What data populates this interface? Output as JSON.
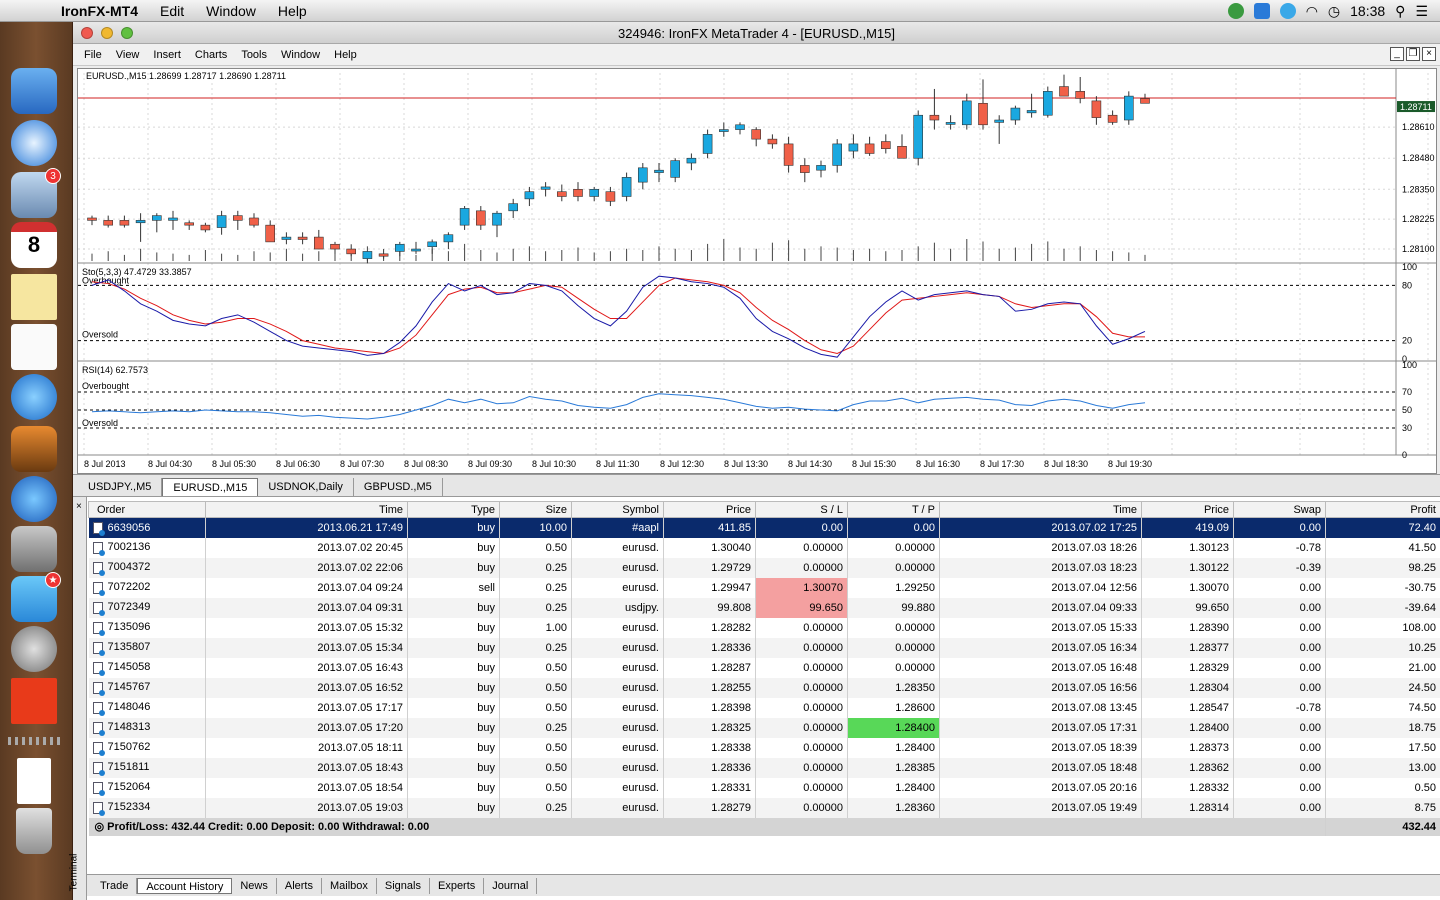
{
  "menubar": {
    "app": "IronFX-MT4",
    "items": [
      "Edit",
      "Window",
      "Help"
    ],
    "clock": "18:38"
  },
  "dock": {
    "items": [
      "finder-icon",
      "safari-icon",
      "mail-icon",
      "calendar-icon",
      "notes-icon",
      "reminders-icon",
      "itunes-icon",
      "iphoto-icon",
      "app-store-icon",
      "system-preferences-icon",
      "twitter-icon",
      "disk-utility-icon",
      "ironfx-icon",
      "document-icon",
      "trash-icon"
    ],
    "mail_badge": "3",
    "calendar_day": "8"
  },
  "window": {
    "title": "324946: IronFX MetaTrader 4 - [EURUSD.,M15]",
    "menu": [
      "File",
      "View",
      "Insert",
      "Charts",
      "Tools",
      "Window",
      "Help"
    ]
  },
  "chart_data": {
    "type": "candlestick",
    "header": "EURUSD.,M15  1.28699 1.28717 1.28690 1.28711",
    "price_labels": [
      "1.28610",
      "1.28480",
      "1.28350",
      "1.28225",
      "1.28100"
    ],
    "current_price": "1.28711",
    "ylim": [
      1.2805,
      1.2882
    ],
    "candles": [
      [
        1.2823,
        1.2824,
        1.282,
        1.2822
      ],
      [
        1.2822,
        1.2824,
        1.2819,
        1.282
      ],
      [
        1.2822,
        1.2824,
        1.2819,
        1.282
      ],
      [
        1.2821,
        1.2825,
        1.2813,
        1.2822
      ],
      [
        1.2822,
        1.2825,
        1.2817,
        1.2824
      ],
      [
        1.2822,
        1.2826,
        1.2818,
        1.2823
      ],
      [
        1.2821,
        1.2822,
        1.2818,
        1.282
      ],
      [
        1.282,
        1.2821,
        1.2817,
        1.2818
      ],
      [
        1.2819,
        1.2826,
        1.2816,
        1.2824
      ],
      [
        1.2824,
        1.2826,
        1.2818,
        1.2822
      ],
      [
        1.2823,
        1.2825,
        1.2819,
        1.282
      ],
      [
        1.282,
        1.2822,
        1.2813,
        1.2813
      ],
      [
        1.2814,
        1.2817,
        1.2812,
        1.2815
      ],
      [
        1.2815,
        1.2817,
        1.2812,
        1.2814
      ],
      [
        1.2815,
        1.2818,
        1.281,
        1.281
      ],
      [
        1.2812,
        1.2813,
        1.2808,
        1.281
      ],
      [
        1.281,
        1.2812,
        1.2807,
        1.2808
      ],
      [
        1.2806,
        1.2809,
        1.2804,
        1.2809
      ],
      [
        1.2808,
        1.281,
        1.2806,
        1.2807
      ],
      [
        1.2809,
        1.2813,
        1.2807,
        1.2812
      ],
      [
        1.281,
        1.2813,
        1.2808,
        1.281
      ],
      [
        1.2811,
        1.2814,
        1.2808,
        1.2813
      ],
      [
        1.2813,
        1.2817,
        1.281,
        1.2816
      ],
      [
        1.282,
        1.2828,
        1.2818,
        1.2827
      ],
      [
        1.2826,
        1.2828,
        1.2818,
        1.282
      ],
      [
        1.282,
        1.2826,
        1.2815,
        1.2825
      ],
      [
        1.2826,
        1.2831,
        1.2823,
        1.2829
      ],
      [
        1.2831,
        1.2836,
        1.2828,
        1.2834
      ],
      [
        1.2835,
        1.2838,
        1.2832,
        1.2836
      ],
      [
        1.2834,
        1.2837,
        1.283,
        1.2832
      ],
      [
        1.2835,
        1.2838,
        1.283,
        1.2832
      ],
      [
        1.2832,
        1.2836,
        1.283,
        1.2835
      ],
      [
        1.2834,
        1.2836,
        1.2828,
        1.283
      ],
      [
        1.2832,
        1.2842,
        1.283,
        1.284
      ],
      [
        1.2838,
        1.2846,
        1.2835,
        1.2844
      ],
      [
        1.2842,
        1.2846,
        1.2838,
        1.2843
      ],
      [
        1.284,
        1.2848,
        1.2838,
        1.2847
      ],
      [
        1.2846,
        1.285,
        1.2843,
        1.2848
      ],
      [
        1.285,
        1.286,
        1.2848,
        1.2858
      ],
      [
        1.286,
        1.2863,
        1.2857,
        1.286
      ],
      [
        1.286,
        1.2863,
        1.2858,
        1.2862
      ],
      [
        1.286,
        1.2861,
        1.2853,
        1.2856
      ],
      [
        1.2856,
        1.2858,
        1.2852,
        1.2854
      ],
      [
        1.2854,
        1.2857,
        1.2842,
        1.2845
      ],
      [
        1.2845,
        1.2848,
        1.2838,
        1.2842
      ],
      [
        1.2843,
        1.2847,
        1.284,
        1.2845
      ],
      [
        1.2845,
        1.2856,
        1.2842,
        1.2854
      ],
      [
        1.2851,
        1.2858,
        1.2848,
        1.2854
      ],
      [
        1.2854,
        1.2857,
        1.2849,
        1.285
      ],
      [
        1.2855,
        1.2858,
        1.285,
        1.2852
      ],
      [
        1.2853,
        1.2858,
        1.285,
        1.2848
      ],
      [
        1.2848,
        1.2868,
        1.2845,
        1.2866
      ],
      [
        1.2866,
        1.2877,
        1.286,
        1.2864
      ],
      [
        1.2863,
        1.2866,
        1.286,
        1.2863
      ],
      [
        1.2862,
        1.2875,
        1.286,
        1.2872
      ],
      [
        1.2871,
        1.2881,
        1.286,
        1.2862
      ],
      [
        1.2863,
        1.2866,
        1.2854,
        1.2864
      ],
      [
        1.2864,
        1.287,
        1.2862,
        1.2869
      ],
      [
        1.2867,
        1.2875,
        1.2865,
        1.2868
      ],
      [
        1.2866,
        1.2878,
        1.2865,
        1.2876
      ],
      [
        1.2878,
        1.2883,
        1.2874,
        1.2874
      ],
      [
        1.2876,
        1.2882,
        1.2871,
        1.2873
      ],
      [
        1.2872,
        1.2874,
        1.2862,
        1.2865
      ],
      [
        1.2866,
        1.2868,
        1.2862,
        1.2863
      ],
      [
        1.2864,
        1.2876,
        1.2862,
        1.2874
      ],
      [
        1.2873,
        1.2875,
        1.2871,
        1.2871
      ]
    ],
    "volumes": [
      6,
      8,
      5,
      10,
      7,
      6,
      5,
      9,
      6,
      5,
      8,
      7,
      10,
      6,
      8,
      7,
      9,
      12,
      6,
      9,
      5,
      10,
      8,
      14,
      9,
      7,
      10,
      12,
      8,
      9,
      11,
      7,
      8,
      10,
      9,
      12,
      10,
      9,
      14,
      18,
      11,
      10,
      15,
      17,
      10,
      12,
      11,
      9,
      10,
      8,
      9,
      12,
      15,
      10,
      18,
      16,
      10,
      11,
      14,
      16,
      10,
      12,
      9,
      8,
      7,
      5
    ],
    "stoch": {
      "label": "Sto(5,3,3) 47.4729 33.3857",
      "overbought": "Overbought",
      "oversold": "Oversold",
      "levels": [
        "100",
        "80",
        "20",
        "0"
      ],
      "main": [
        80,
        86,
        74,
        60,
        52,
        42,
        38,
        36,
        44,
        48,
        40,
        30,
        20,
        14,
        12,
        10,
        8,
        4,
        6,
        18,
        36,
        62,
        82,
        74,
        80,
        70,
        72,
        82,
        80,
        74,
        58,
        44,
        36,
        52,
        78,
        90,
        88,
        84,
        82,
        78,
        66,
        44,
        30,
        22,
        12,
        5,
        2,
        24,
        46,
        62,
        74,
        64,
        70,
        72,
        74,
        70,
        68,
        52,
        54,
        60,
        62,
        60,
        36,
        16,
        22,
        30
      ],
      "signal": [
        84,
        82,
        76,
        66,
        58,
        48,
        42,
        38,
        40,
        44,
        44,
        38,
        30,
        20,
        16,
        12,
        10,
        8,
        6,
        12,
        26,
        48,
        70,
        76,
        78,
        72,
        72,
        76,
        80,
        78,
        66,
        54,
        44,
        44,
        62,
        80,
        88,
        86,
        84,
        80,
        72,
        56,
        42,
        32,
        20,
        10,
        6,
        14,
        32,
        50,
        64,
        66,
        68,
        70,
        72,
        70,
        68,
        60,
        56,
        58,
        60,
        60,
        46,
        28,
        24,
        24
      ]
    },
    "rsi": {
      "label": "RSI(14) 62.7573",
      "overbought": "Overbought",
      "oversold": "Oversold",
      "levels": [
        "100",
        "70",
        "50",
        "30",
        "0"
      ],
      "values": [
        48,
        49,
        48,
        47,
        48,
        49,
        48,
        50,
        49,
        48,
        48,
        47,
        45,
        43,
        44,
        42,
        41,
        40,
        42,
        45,
        50,
        55,
        62,
        58,
        62,
        57,
        58,
        65,
        62,
        60,
        55,
        53,
        52,
        56,
        64,
        68,
        67,
        66,
        64,
        62,
        58,
        54,
        52,
        53,
        51,
        50,
        49,
        56,
        60,
        60,
        63,
        58,
        62,
        63,
        64,
        62,
        61,
        56,
        55,
        60,
        62,
        60,
        55,
        52,
        56,
        58
      ]
    },
    "time_labels": [
      "8 Jul 2013",
      "8 Jul 04:30",
      "8 Jul 05:30",
      "8 Jul 06:30",
      "8 Jul 07:30",
      "8 Jul 08:30",
      "8 Jul 09:30",
      "8 Jul 10:30",
      "8 Jul 11:30",
      "8 Jul 12:30",
      "8 Jul 13:30",
      "8 Jul 14:30",
      "8 Jul 15:30",
      "8 Jul 16:30",
      "8 Jul 17:30",
      "8 Jul 18:30",
      "8 Jul 19:30"
    ],
    "colors": {
      "bull": "#1aa8e0",
      "bear": "#f06048",
      "stoch_main": "#1a1aa8",
      "stoch_signal": "#e01818",
      "rsi": "#2a7ad8",
      "price_line": "#d02020"
    }
  },
  "chart_tabs": [
    "USDJPY.,M5",
    "EURUSD.,M15",
    "USDNOK,Daily",
    "GBPUSD.,M5"
  ],
  "terminal": {
    "label": "Terminal",
    "columns": [
      "Order",
      "Time",
      "Type",
      "Size",
      "Symbol",
      "Price",
      "S / L",
      "T / P",
      "Time",
      "Price",
      "Swap",
      "Profit"
    ],
    "rows": [
      [
        "6639056",
        "2013.06.21 17:49",
        "buy",
        "10.00",
        "#aapl",
        "411.85",
        "0.00",
        "0.00",
        "2013.07.02 17:25",
        "419.09",
        "0.00",
        "72.40"
      ],
      [
        "7002136",
        "2013.07.02 20:45",
        "buy",
        "0.50",
        "eurusd.",
        "1.30040",
        "0.00000",
        "0.00000",
        "2013.07.03 18:26",
        "1.30123",
        "-0.78",
        "41.50"
      ],
      [
        "7004372",
        "2013.07.02 22:06",
        "buy",
        "0.25",
        "eurusd.",
        "1.29729",
        "0.00000",
        "0.00000",
        "2013.07.03 18:23",
        "1.30122",
        "-0.39",
        "98.25"
      ],
      [
        "7072202",
        "2013.07.04 09:24",
        "sell",
        "0.25",
        "eurusd.",
        "1.29947",
        "1.30070",
        "1.29250",
        "2013.07.04 12:56",
        "1.30070",
        "0.00",
        "-30.75"
      ],
      [
        "7072349",
        "2013.07.04 09:31",
        "buy",
        "0.25",
        "usdjpy.",
        "99.808",
        "99.650",
        "99.880",
        "2013.07.04 09:33",
        "99.650",
        "0.00",
        "-39.64"
      ],
      [
        "7135096",
        "2013.07.05 15:32",
        "buy",
        "1.00",
        "eurusd.",
        "1.28282",
        "0.00000",
        "0.00000",
        "2013.07.05 15:33",
        "1.28390",
        "0.00",
        "108.00"
      ],
      [
        "7135807",
        "2013.07.05 15:34",
        "buy",
        "0.25",
        "eurusd.",
        "1.28336",
        "0.00000",
        "0.00000",
        "2013.07.05 16:34",
        "1.28377",
        "0.00",
        "10.25"
      ],
      [
        "7145058",
        "2013.07.05 16:43",
        "buy",
        "0.50",
        "eurusd.",
        "1.28287",
        "0.00000",
        "0.00000",
        "2013.07.05 16:48",
        "1.28329",
        "0.00",
        "21.00"
      ],
      [
        "7145767",
        "2013.07.05 16:52",
        "buy",
        "0.50",
        "eurusd.",
        "1.28255",
        "0.00000",
        "1.28350",
        "2013.07.05 16:56",
        "1.28304",
        "0.00",
        "24.50"
      ],
      [
        "7148046",
        "2013.07.05 17:17",
        "buy",
        "0.50",
        "eurusd.",
        "1.28398",
        "0.00000",
        "1.28600",
        "2013.07.08 13:45",
        "1.28547",
        "-0.78",
        "74.50"
      ],
      [
        "7148313",
        "2013.07.05 17:20",
        "buy",
        "0.25",
        "eurusd.",
        "1.28325",
        "0.00000",
        "1.28400",
        "2013.07.05 17:31",
        "1.28400",
        "0.00",
        "18.75"
      ],
      [
        "7150762",
        "2013.07.05 18:11",
        "buy",
        "0.50",
        "eurusd.",
        "1.28338",
        "0.00000",
        "1.28400",
        "2013.07.05 18:39",
        "1.28373",
        "0.00",
        "17.50"
      ],
      [
        "7151811",
        "2013.07.05 18:43",
        "buy",
        "0.50",
        "eurusd.",
        "1.28336",
        "0.00000",
        "1.28385",
        "2013.07.05 18:48",
        "1.28362",
        "0.00",
        "13.00"
      ],
      [
        "7152064",
        "2013.07.05 18:54",
        "buy",
        "0.50",
        "eurusd.",
        "1.28331",
        "0.00000",
        "1.28400",
        "2013.07.05 20:16",
        "1.28332",
        "0.00",
        "0.50"
      ],
      [
        "7152334",
        "2013.07.05 19:03",
        "buy",
        "0.25",
        "eurusd.",
        "1.28279",
        "0.00000",
        "1.28360",
        "2013.07.05 19:49",
        "1.28314",
        "0.00",
        "8.75"
      ]
    ],
    "summary": "Profit/Loss: 432.44  Credit: 0.00  Deposit: 0.00  Withdrawal: 0.00",
    "summary_total": "432.44",
    "tabs": [
      "Trade",
      "Account History",
      "News",
      "Alerts",
      "Mailbox",
      "Signals",
      "Experts",
      "Journal"
    ]
  }
}
